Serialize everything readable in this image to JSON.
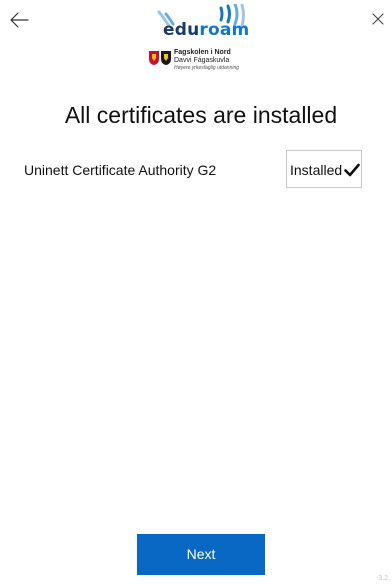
{
  "header": {
    "back_icon": "arrow-left-icon",
    "close_icon": "close-icon",
    "logo": {
      "text_part1": "edu",
      "text_part2": "roam",
      "wave_color": "#1576c2",
      "text_color_dark": "#1a3a6b",
      "text_color_light": "#1576c2"
    },
    "institution": {
      "line1": "Fagskolen i Nord",
      "line2": "Davvi Fágaskuvla",
      "line3": "Høyere yrkesfaglig utdanning"
    }
  },
  "main": {
    "title": "All certificates are installed",
    "certificates": [
      {
        "name": "Uninett Certificate Authority G2",
        "status": "Installed",
        "status_icon": "checkmark-icon"
      }
    ]
  },
  "footer": {
    "next_label": "Next",
    "version": "3.2."
  },
  "colors": {
    "accent": "#0a68c5",
    "background": "#ffffff",
    "text": "#111111"
  }
}
